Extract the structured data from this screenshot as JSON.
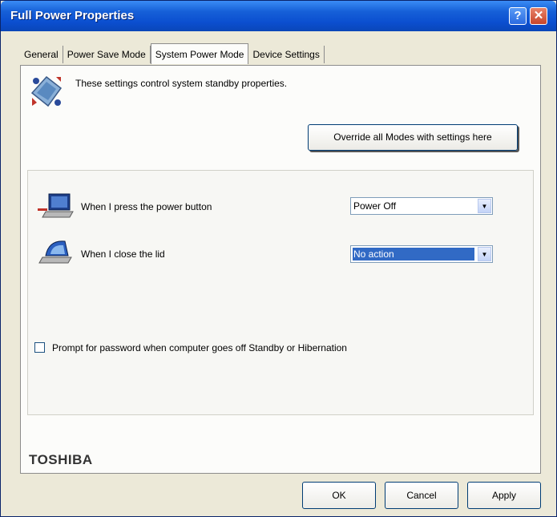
{
  "window": {
    "title": "Full Power Properties",
    "help_glyph": "?",
    "close_glyph": "✕"
  },
  "tabs": [
    {
      "label": "General",
      "active": false
    },
    {
      "label": "Power Save Mode",
      "active": false
    },
    {
      "label": "System Power Mode",
      "active": true
    },
    {
      "label": "Device Settings",
      "active": false
    }
  ],
  "intro": {
    "text": "These settings control system standby properties."
  },
  "override_button": {
    "label": "Override all Modes with settings here"
  },
  "settings": {
    "power_button": {
      "label": "When I press the power button",
      "value": "Power Off"
    },
    "lid": {
      "label": "When I close the lid",
      "value": "No action"
    }
  },
  "password_prompt": {
    "label": "Prompt for password when computer goes off Standby or Hibernation",
    "checked": false
  },
  "brand": "TOSHIBA",
  "buttons": {
    "ok": "OK",
    "cancel": "Cancel",
    "apply": "Apply"
  },
  "icons": {
    "intro": "power-settings-icon",
    "power_button": "laptop-power-icon",
    "lid": "laptop-lid-icon",
    "dropdown": "chevron-down-icon"
  },
  "colors": {
    "titlebar": "#0b4fd0",
    "selection": "#316ac5",
    "dialog_bg": "#ece9d8"
  }
}
